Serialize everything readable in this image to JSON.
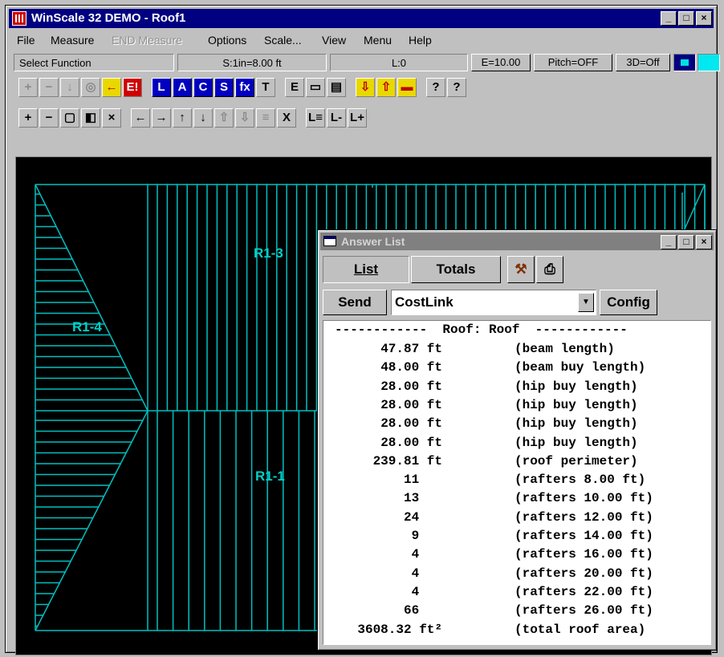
{
  "window": {
    "title": "WinScale 32 DEMO - Roof1",
    "min": "_",
    "max": "□",
    "close": "×"
  },
  "menu": [
    {
      "label": "File",
      "disabled": false
    },
    {
      "label": "Measure",
      "disabled": false
    },
    {
      "label": "END Measure",
      "disabled": true
    },
    {
      "label": "Options",
      "disabled": false
    },
    {
      "label": "Scale...",
      "disabled": false
    },
    {
      "label": "View",
      "disabled": false
    },
    {
      "label": "Menu",
      "disabled": false
    },
    {
      "label": "Help",
      "disabled": false
    }
  ],
  "status": {
    "function": "Select Function",
    "scale": "S:1in=8.00 ft",
    "layer": "L:0",
    "e_button": "E=10.00",
    "pitch_button": "Pitch=OFF",
    "three_d_button": "3D=Off"
  },
  "drawing": {
    "labels": {
      "r13": "R1-3",
      "r14": "R1-4",
      "r11": "R1-1"
    },
    "line_color": "#00c0c0"
  },
  "answer_list": {
    "title": "Answer List",
    "tabs": {
      "list": "List",
      "totals": "Totals"
    },
    "send_label": "Send",
    "combo_value": "CostLink",
    "config_label": "Config",
    "header": "------------  Roof: Roof  ------------",
    "rows": [
      {
        "value": "47.87 ft",
        "desc": "(beam length)"
      },
      {
        "value": "48.00 ft",
        "desc": "(beam buy length)"
      },
      {
        "value": "28.00 ft",
        "desc": "(hip buy length)"
      },
      {
        "value": "28.00 ft",
        "desc": "(hip buy length)"
      },
      {
        "value": "28.00 ft",
        "desc": "(hip buy length)"
      },
      {
        "value": "28.00 ft",
        "desc": "(hip buy length)"
      },
      {
        "value": "239.81 ft",
        "desc": "(roof perimeter)"
      },
      {
        "value": "11   ",
        "desc": "(rafters 8.00 ft)"
      },
      {
        "value": "13   ",
        "desc": "(rafters 10.00 ft)"
      },
      {
        "value": "24   ",
        "desc": "(rafters 12.00 ft)"
      },
      {
        "value": "9   ",
        "desc": "(rafters 14.00 ft)"
      },
      {
        "value": "4   ",
        "desc": "(rafters 16.00 ft)"
      },
      {
        "value": "4   ",
        "desc": "(rafters 20.00 ft)"
      },
      {
        "value": "4   ",
        "desc": "(rafters 22.00 ft)"
      },
      {
        "value": "66   ",
        "desc": "(rafters 26.00 ft)"
      },
      {
        "value": "3608.32 ft²",
        "desc": "(total roof area)"
      }
    ]
  },
  "toolbar1": [
    {
      "icon": "plus-icon",
      "glyph": "+",
      "style": "dis"
    },
    {
      "icon": "minus-icon",
      "glyph": "−",
      "style": "dis"
    },
    {
      "icon": "down-arrow-icon",
      "glyph": "↓",
      "style": "dis"
    },
    {
      "icon": "circle-icon",
      "glyph": "◎",
      "style": "dis"
    },
    {
      "icon": "back-arrow-icon",
      "glyph": "←",
      "style": "yel"
    },
    {
      "icon": "erase-icon",
      "glyph": "E!",
      "style": "red"
    },
    {
      "icon": "gap"
    },
    {
      "icon": "line-tool-icon",
      "glyph": "L",
      "style": "blue"
    },
    {
      "icon": "area-tool-icon",
      "glyph": "A",
      "style": "blue"
    },
    {
      "icon": "count-tool-icon",
      "glyph": "C",
      "style": "blue"
    },
    {
      "icon": "surface-tool-icon",
      "glyph": "S",
      "style": "blue"
    },
    {
      "icon": "function-tool-icon",
      "glyph": "fx",
      "style": "blue"
    },
    {
      "icon": "text-tool-icon",
      "glyph": "T",
      "style": ""
    },
    {
      "icon": "gap"
    },
    {
      "icon": "edit-icon",
      "glyph": "E",
      "style": ""
    },
    {
      "icon": "keyboard-icon",
      "glyph": "▭",
      "style": ""
    },
    {
      "icon": "print-preview-icon",
      "glyph": "▤",
      "style": ""
    },
    {
      "icon": "gap"
    },
    {
      "icon": "import-icon",
      "glyph": "⇩",
      "style": "yel"
    },
    {
      "icon": "export-icon",
      "glyph": "⇧",
      "style": "yel"
    },
    {
      "icon": "folder-icon",
      "glyph": "▬",
      "style": "yel"
    },
    {
      "icon": "gap"
    },
    {
      "icon": "help-icon",
      "glyph": "?",
      "style": ""
    },
    {
      "icon": "context-help-icon",
      "glyph": "?",
      "style": ""
    }
  ],
  "toolbar2": [
    {
      "icon": "zoom-in-icon",
      "glyph": "+",
      "style": ""
    },
    {
      "icon": "zoom-out-icon",
      "glyph": "−",
      "style": ""
    },
    {
      "icon": "zoom-window-icon",
      "glyph": "▢",
      "style": ""
    },
    {
      "icon": "zoom-all-icon",
      "glyph": "◧",
      "style": ""
    },
    {
      "icon": "zoom-cancel-icon",
      "glyph": "×",
      "style": ""
    },
    {
      "icon": "gap"
    },
    {
      "icon": "pan-left-icon",
      "glyph": "←",
      "style": ""
    },
    {
      "icon": "pan-right-icon",
      "glyph": "→",
      "style": ""
    },
    {
      "icon": "pan-up-icon",
      "glyph": "↑",
      "style": ""
    },
    {
      "icon": "pan-down-icon",
      "glyph": "↓",
      "style": ""
    },
    {
      "icon": "layer-up-icon",
      "glyph": "⇧",
      "style": "dis"
    },
    {
      "icon": "layer-down-icon",
      "glyph": "⇩",
      "style": "dis"
    },
    {
      "icon": "layer-flat-icon",
      "glyph": "≡",
      "style": "dis"
    },
    {
      "icon": "delete-segment-icon",
      "glyph": "X",
      "style": ""
    },
    {
      "icon": "gap"
    },
    {
      "icon": "layer-list-icon",
      "glyph": "L≡",
      "style": ""
    },
    {
      "icon": "layer-prev-icon",
      "glyph": "L-",
      "style": ""
    },
    {
      "icon": "layer-next-icon",
      "glyph": "L+",
      "style": ""
    }
  ]
}
